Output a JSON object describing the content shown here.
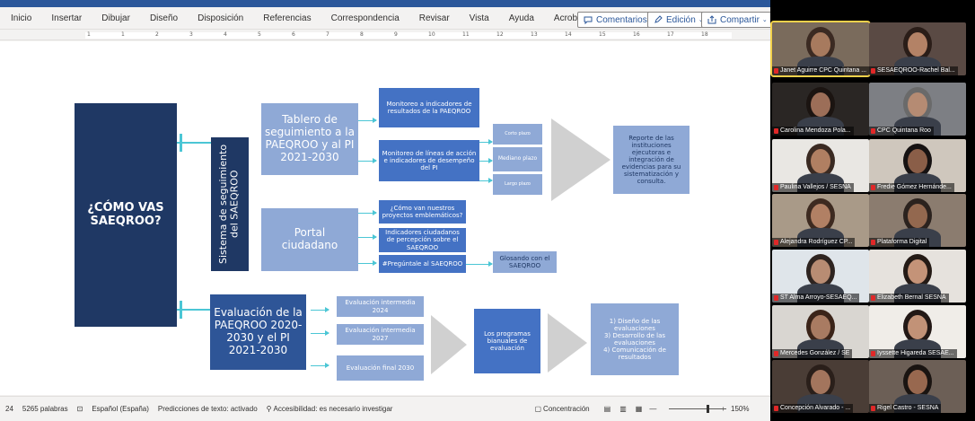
{
  "ribbon": {
    "tabs": [
      "Inicio",
      "Insertar",
      "Dibujar",
      "Diseño",
      "Disposición",
      "Referencias",
      "Correspondencia",
      "Revisar",
      "Vista",
      "Ayuda",
      "Acrobat"
    ],
    "comments_label": "Comentarios",
    "edit_label": "Edición",
    "share_label": "Compartir"
  },
  "ruler": {
    "numbers": [
      "1",
      "1",
      "2",
      "3",
      "4",
      "5",
      "6",
      "7",
      "8",
      "9",
      "10",
      "11",
      "12",
      "13",
      "14",
      "15",
      "16",
      "17",
      "18"
    ]
  },
  "diagram": {
    "question": "¿CÓMO VAS SAEQROO?",
    "system_label": "Sistema de seguimiento del SAEQROO",
    "tablero": "Tablero de seguimiento a la PAEQROO y al PI 2021-2030",
    "monitoreo_indicadores": "Monitoreo a indicadores de resultados de la PAEQROO",
    "monitoreo_lineas": "Monitoreo de líneas de acción e indicadores de desempeño del PI",
    "corto": "Corto plazo",
    "mediano": "Mediano plazo",
    "largo": "Largo plazo",
    "reporte": "Reporte de las instituciones ejecutoras e integración de evidencias para su sistematización y consulta.",
    "portal": "Portal ciudadano",
    "como_van": "¿Cómo van nuestros proyectos emblemáticos?",
    "indicadores_ciudadanos": "Indicadores ciudadanos de percepción sobre el SAEQROO",
    "preguntale": "#Pregúntale al SAEQROO",
    "glosando": "Glosando con el SAEQROO",
    "evaluacion": "Evaluación de la PAEQROO 2020-2030 y el PI 2021-2030",
    "eval_intermedia_2024": "Evaluación intermedia 2024",
    "eval_intermedia_2027": "Evaluación intermedia 2027",
    "eval_final_2030": "Evaluación final 2030",
    "programas": "Los programas bianuales de evaluación",
    "pasos": "1) Diseño de las evaluaciones\n3) Desarrollo de las evaluaciones\n4) Comunicación de resultados"
  },
  "status": {
    "page": "24",
    "words": "5265 palabras",
    "language": "Español (España)",
    "predictions": "Predicciones de texto: activado",
    "accessibility": "Accesibilidad: es necesario investigar",
    "focus": "Concentración",
    "zoom": "150%"
  },
  "participants": [
    {
      "name": "Janet Aguirre CPC Quintana ...",
      "bg": "#7a6b5c",
      "skin": "#a77a5e",
      "hair": "#3b2a22",
      "active": true
    },
    {
      "name": "SESAEQROO-Rachel Bal...",
      "bg": "#5a4a44",
      "skin": "#b38266",
      "hair": "#2a1d18",
      "active": false
    },
    {
      "name": "Carolina Mendoza Pola...",
      "bg": "#2a2624",
      "skin": "#9c6e58",
      "hair": "#1b1411",
      "active": false
    },
    {
      "name": "CPC Quintana Roo",
      "bg": "#7d7f84",
      "skin": "#b58b73",
      "hair": "#6a6a6a",
      "active": false
    },
    {
      "name": "Paulina Vallejos / SESNA",
      "bg": "#e9e7e3",
      "skin": "#b07f62",
      "hair": "#3a2a22",
      "active": false
    },
    {
      "name": "Fredie Gómez Hernánde...",
      "bg": "#cfc7bd",
      "skin": "#8a5e48",
      "hair": "#161212",
      "active": false
    },
    {
      "name": "Alejandra Rodríguez CP...",
      "bg": "#a99a88",
      "skin": "#b18064",
      "hair": "#3d2a20",
      "active": false
    },
    {
      "name": "Plataforma Digital",
      "bg": "#8b7c6f",
      "skin": "#93684f",
      "hair": "#2b221e",
      "active": false
    },
    {
      "name": "ST Alma Arroyo-SESAEQ...",
      "bg": "#dfe5ea",
      "skin": "#b88c73",
      "hair": "#2e2420",
      "active": false
    },
    {
      "name": "Elizabeth Bernal SESNA",
      "bg": "#e6e2dd",
      "skin": "#c49378",
      "hair": "#241a15",
      "active": false
    },
    {
      "name": "Mercedes González / SE",
      "bg": "#d9d6d1",
      "skin": "#a97b62",
      "hair": "#3b2419",
      "active": false
    },
    {
      "name": "Iyssette Higareda SESAE...",
      "bg": "#f0ede8",
      "skin": "#c29277",
      "hair": "#221815",
      "active": false
    },
    {
      "name": "Concepción Alvarado - ...",
      "bg": "#4a3d36",
      "skin": "#a3755d",
      "hair": "#2a1f1a",
      "active": false
    },
    {
      "name": "Rigel Castro - SESNA",
      "bg": "#6c5f56",
      "skin": "#98684f",
      "hair": "#1a1411",
      "active": false
    }
  ],
  "colors": {
    "accent": "#4bc6d5",
    "dark": "#1f3864",
    "mid": "#2e5597",
    "blue": "#4472c4",
    "light": "#8fa9d6",
    "word": "#2b579a"
  }
}
